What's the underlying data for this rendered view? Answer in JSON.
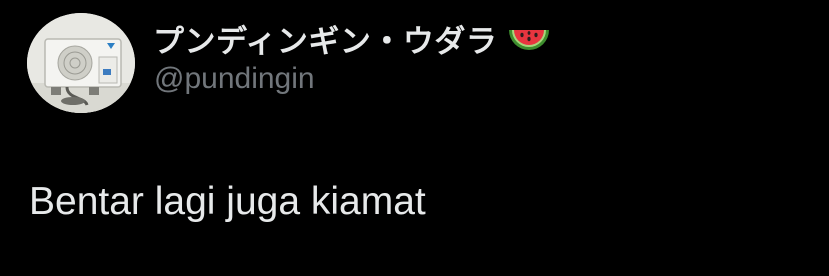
{
  "author": {
    "display_name": "プンディンギン・ウダラ",
    "emoji_icon": "watermelon-emoji",
    "handle": "@pundingin",
    "avatar_icon": "air-conditioner-photo"
  },
  "tweet": {
    "text": "Bentar lagi juga kiamat"
  },
  "colors": {
    "background": "#000000",
    "primary_text": "#e7e9ea",
    "secondary_text": "#71767b"
  }
}
